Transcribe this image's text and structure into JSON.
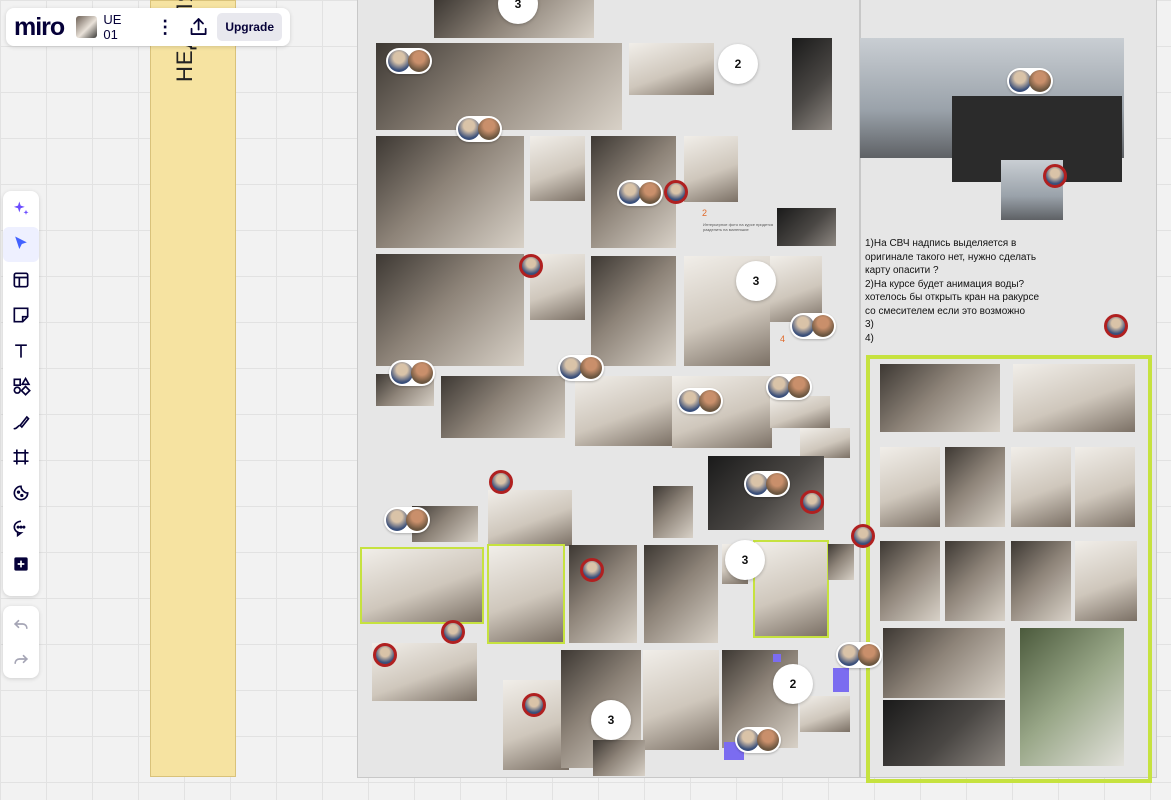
{
  "app": {
    "logo": "miro",
    "board_name": "UE 01",
    "upgrade_label": "Upgrade"
  },
  "canvas": {
    "strip_label": "НЕДЕЛЯ",
    "notes": [
      "1)На СВЧ надпись выделяется в",
      "оригинале такого нет, нужно сделать",
      "карту опасити ?",
      "2)На курсе будет анимация воды?",
      "хотелось бы открыть кран на ракурсе",
      "со смесителем если это возможно",
      "3)",
      "4)"
    ],
    "comment_counts": [
      "3",
      "2",
      "3",
      "3",
      "2",
      "3"
    ],
    "annotation_numbers": [
      "2",
      "4"
    ],
    "tiny_caption": "Интерьерное фото на курсе придется разделить на маленькие"
  },
  "toolbar": {
    "tools": [
      "ai-sparkle-icon",
      "select-icon",
      "templates-icon",
      "sticky-note-icon",
      "text-icon",
      "shapes-icon",
      "pen-icon",
      "frame-icon",
      "stickers-icon",
      "comment-icon",
      "more-tools-icon"
    ],
    "history": [
      "undo-icon",
      "redo-icon"
    ]
  },
  "colors": {
    "accent": "#4262ff",
    "frame_highlight": "#c6e23f",
    "sticky": "#f6e3a1",
    "avatar_ring": "#b02020"
  }
}
